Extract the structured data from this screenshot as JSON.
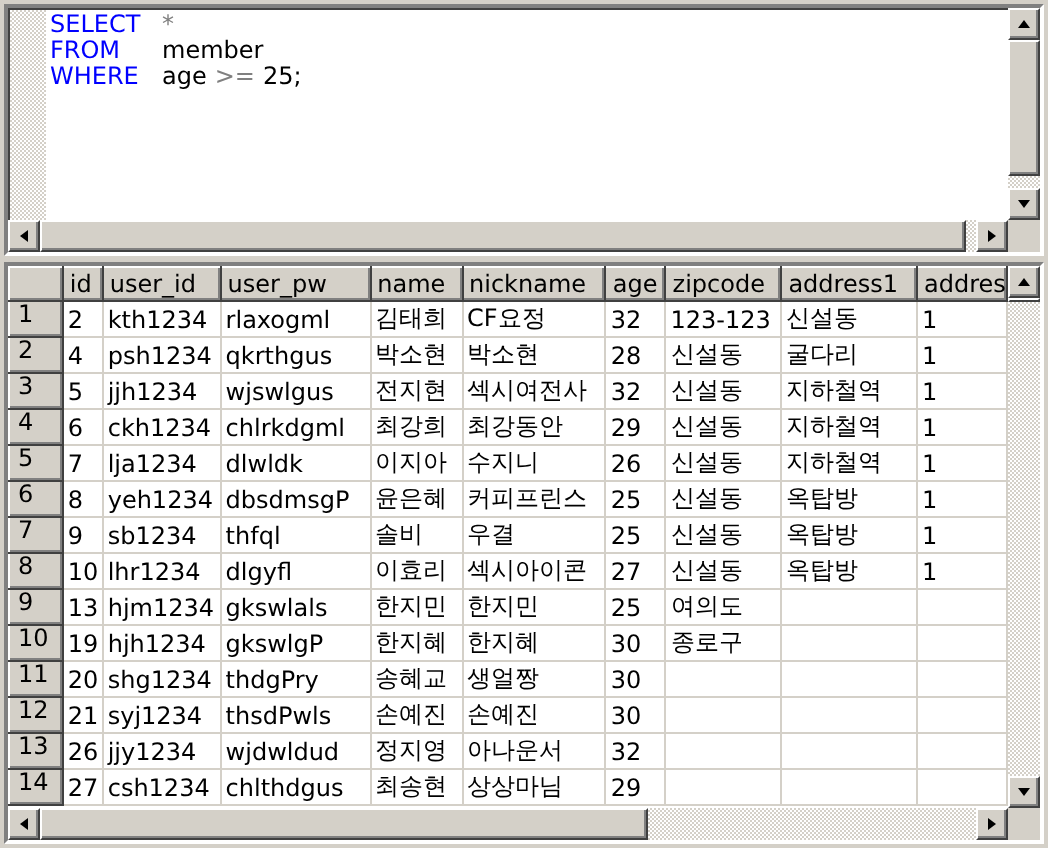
{
  "editor": {
    "lines": [
      {
        "tokens": [
          {
            "kind": "keyword",
            "text": "SELECT"
          },
          {
            "kind": "operator",
            "text": "*"
          }
        ]
      },
      {
        "tokens": [
          {
            "kind": "keyword",
            "text": "FROM"
          },
          {
            "kind": "text",
            "text": "member"
          }
        ]
      },
      {
        "tokens": [
          {
            "kind": "keyword",
            "text": "WHERE"
          },
          {
            "kind": "text",
            "text": "age"
          },
          {
            "kind": "operator",
            "text": ">="
          },
          {
            "kind": "text",
            "text": "25;"
          }
        ]
      }
    ]
  },
  "table": {
    "columns": [
      "id",
      "user_id",
      "user_pw",
      "name",
      "nickname",
      "age",
      "zipcode",
      "address1",
      "addres"
    ],
    "rows": [
      {
        "row": "1",
        "cells": [
          "2",
          "kth1234",
          "rlaxogml",
          "김태희",
          "CF요정",
          "32",
          "123-123",
          "신설동",
          "1"
        ]
      },
      {
        "row": "2",
        "cells": [
          "4",
          "psh1234",
          "qkrthgus",
          "박소현",
          "박소현",
          "28",
          "신설동",
          "굴다리",
          "1"
        ]
      },
      {
        "row": "3",
        "cells": [
          "5",
          "jjh1234",
          "wjswlgus",
          "전지현",
          "섹시여전사",
          "32",
          "신설동",
          "지하철역",
          "1"
        ]
      },
      {
        "row": "4",
        "cells": [
          "6",
          "ckh1234",
          "chlrkdgml",
          "최강희",
          "최강동안",
          "29",
          "신설동",
          "지하철역",
          "1"
        ]
      },
      {
        "row": "5",
        "cells": [
          "7",
          "lja1234",
          "dlwldk",
          "이지아",
          "수지니",
          "26",
          "신설동",
          "지하철역",
          "1"
        ]
      },
      {
        "row": "6",
        "cells": [
          "8",
          "yeh1234",
          "dbsdmsgP",
          "윤은혜",
          "커피프린스",
          "25",
          "신설동",
          "옥탑방",
          "1"
        ]
      },
      {
        "row": "7",
        "cells": [
          "9",
          "sb1234",
          "thfql",
          "솔비",
          "우결",
          "25",
          "신설동",
          "옥탑방",
          "1"
        ]
      },
      {
        "row": "8",
        "cells": [
          "10",
          "lhr1234",
          "dlgyfl",
          "이효리",
          "섹시아이콘",
          "27",
          "신설동",
          "옥탑방",
          "1"
        ]
      },
      {
        "row": "9",
        "cells": [
          "13",
          "hjm1234",
          "gkswlals",
          "한지민",
          "한지민",
          "25",
          "여의도",
          "",
          ""
        ]
      },
      {
        "row": "10",
        "cells": [
          "19",
          "hjh1234",
          "gkswlgP",
          "한지혜",
          "한지혜",
          "30",
          "종로구",
          "",
          ""
        ]
      },
      {
        "row": "11",
        "cells": [
          "20",
          "shg1234",
          "thdgPry",
          "송혜교",
          "생얼짱",
          "30",
          "",
          "",
          ""
        ]
      },
      {
        "row": "12",
        "cells": [
          "21",
          "syj1234",
          "thsdPwls",
          "손예진",
          "손예진",
          "30",
          "",
          "",
          ""
        ]
      },
      {
        "row": "13",
        "cells": [
          "26",
          "jjy1234",
          "wjdwldud",
          "정지영",
          "아나운서",
          "32",
          "",
          "",
          ""
        ]
      },
      {
        "row": "14",
        "cells": [
          "27",
          "csh1234",
          "chlthdgus",
          "최송현",
          "상상마님",
          "29",
          "",
          "",
          ""
        ]
      }
    ]
  }
}
